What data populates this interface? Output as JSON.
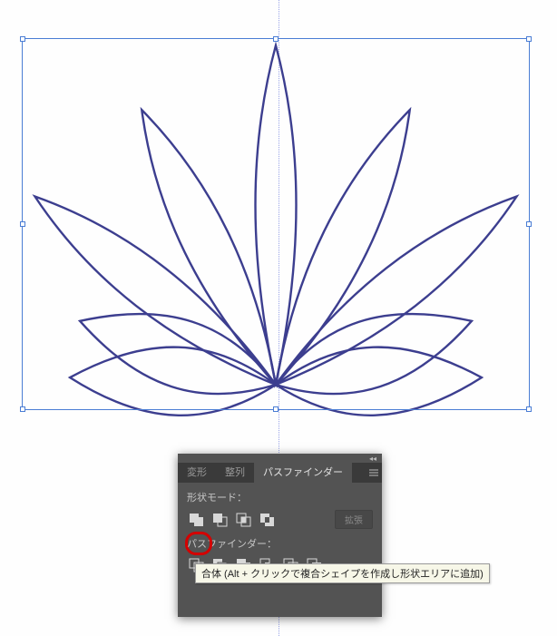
{
  "panel": {
    "tabs": [
      "変形",
      "整列",
      "パスファインダー"
    ],
    "active_tab_index": 2,
    "shape_mode_label": "形状モード：",
    "pathfinder_label": "パスファインダー：",
    "expand_label": "拡張",
    "shape_mode_icons": [
      "unite-icon",
      "minus-front-icon",
      "intersect-icon",
      "exclude-icon"
    ],
    "pathfinder_icons": [
      "divide-icon",
      "trim-icon",
      "merge-icon",
      "crop-icon",
      "outline-icon",
      "minus-back-icon"
    ]
  },
  "tooltip": {
    "text": "合体 (Alt + クリックで複合シェイプを作成し形状エリアに追加)"
  },
  "colors": {
    "selection": "#4a7dd4",
    "leaf_stroke": "#3c3e8f",
    "panel_bg": "#535353",
    "highlight": "#d40000"
  },
  "chart_data": {
    "type": "illustration",
    "description": "Lotus/flower composed of 9 leaf-shaped outlined paths radiating from a common base point, selected with bounding box. Vertical center guide present.",
    "leaf_count": 9
  }
}
